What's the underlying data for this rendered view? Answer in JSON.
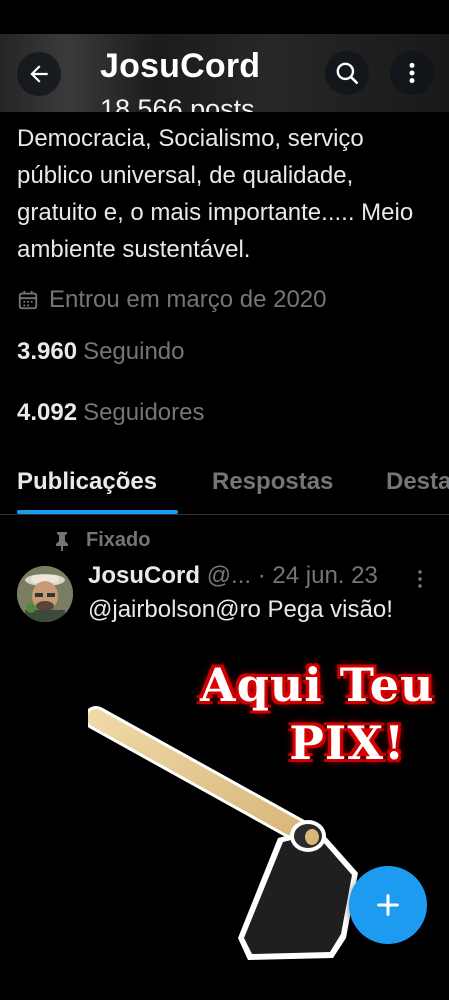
{
  "header": {
    "title": "JosuCord",
    "subtitle": "18.566 posts",
    "back_icon": "arrow-left-icon",
    "search_icon": "search-icon",
    "more_icon": "more-vertical-icon"
  },
  "profile": {
    "bio": "Democracia, Socialismo, serviço público universal, de qualidade, gratuito e, o mais importante..... Meio ambiente sustentável.",
    "joined": "Entrou em março de 2020",
    "following_count": "3.960",
    "following_label": "Seguindo",
    "followers_count": "4.092",
    "followers_label": "Seguidores"
  },
  "tabs": [
    {
      "label": "Publicações",
      "active": true
    },
    {
      "label": "Respostas",
      "active": false
    },
    {
      "label": "Destaques",
      "active": false
    }
  ],
  "tweet": {
    "pinned_label": "Fixado",
    "author_name": "JosuCord",
    "author_handle": "@...",
    "date": "· 24 jun. 23",
    "text": "@jairbolson@ro  Pega visão!",
    "media_caption_line1": "Aqui Teu",
    "media_caption_line2": "PIX!"
  },
  "fab": {
    "icon": "plus-icon"
  },
  "colors": {
    "accent": "#1d9bf0",
    "secondary_text": "#71767b",
    "primary_text": "#e7e9ea",
    "background": "#000000"
  }
}
